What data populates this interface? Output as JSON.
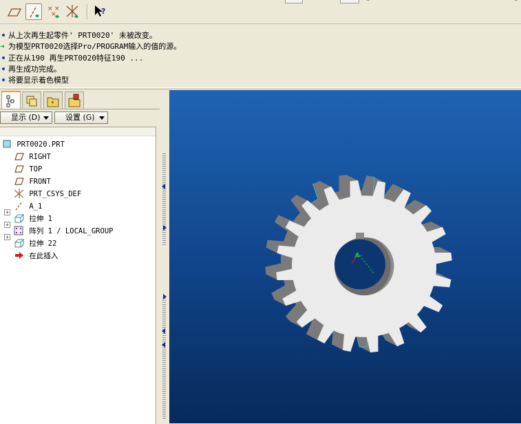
{
  "toolbar": {
    "buttons": [
      {
        "name": "datum-plane-display-toggle",
        "active": false
      },
      {
        "name": "datum-axis-display-toggle",
        "active": true
      },
      {
        "name": "datum-point-display-toggle",
        "active": false
      },
      {
        "name": "coordinate-system-display-toggle",
        "active": false
      },
      {
        "name": "context-help-button",
        "active": false
      }
    ]
  },
  "messages": [
    {
      "type": "info",
      "text": "从上次再生起零件' PRT0020' 未被改变。"
    },
    {
      "type": "prompt",
      "text": "为模型PRT0020选择Pro/PROGRAM输入的值的源。"
    },
    {
      "type": "info",
      "text": "正在从190 再生PRT0020特征190 ..."
    },
    {
      "type": "info",
      "text": "再生成功完成。"
    },
    {
      "type": "info",
      "text": "将要显示着色模型"
    }
  ],
  "navigator": {
    "show_menu": "显示 (D)",
    "settings_menu": "设置 (G)"
  },
  "model_tree": [
    {
      "label": "PRT0020.PRT",
      "icon": "part-icon",
      "level": 0,
      "expandable": false
    },
    {
      "label": "RIGHT",
      "icon": "datum-plane-icon",
      "level": 1,
      "expandable": false
    },
    {
      "label": "TOP",
      "icon": "datum-plane-icon",
      "level": 1,
      "expandable": false
    },
    {
      "label": "FRONT",
      "icon": "datum-plane-icon",
      "level": 1,
      "expandable": false
    },
    {
      "label": "PRT_CSYS_DEF",
      "icon": "coordinate-system-icon",
      "level": 1,
      "expandable": false
    },
    {
      "label": "A_1",
      "icon": "datum-axis-icon",
      "level": 1,
      "expandable": false
    },
    {
      "label": "拉伸 1",
      "icon": "extrude-icon",
      "level": 1,
      "expandable": true
    },
    {
      "label": "阵列 1 / LOCAL_GROUP",
      "icon": "pattern-icon",
      "level": 1,
      "expandable": true
    },
    {
      "label": "拉伸 22",
      "icon": "extrude-icon",
      "level": 1,
      "expandable": true
    },
    {
      "label": "在此插入",
      "icon": "insert-here-arrow-icon",
      "level": 1,
      "expandable": false
    }
  ],
  "viewport": {
    "model": "spur-gear",
    "teeth": 20,
    "colors": {
      "background_top": "#1e64b4",
      "background_bottom": "#062a5c",
      "gear_face": "#ebebeb",
      "gear_side": "#7a7a7a"
    }
  }
}
